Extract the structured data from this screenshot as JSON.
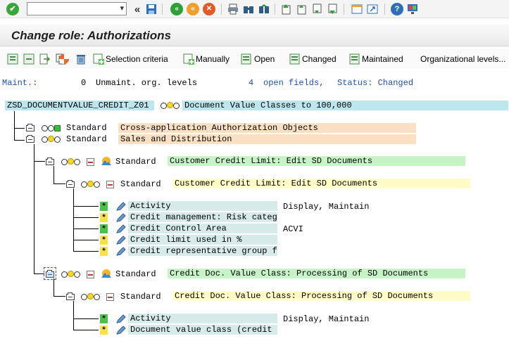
{
  "window": {
    "title": "Change role: Authorizations"
  },
  "colors": {
    "role_bg": "#bde6ee",
    "orange_bg": "#fbe0c4",
    "green_bg": "#c7f4c7",
    "yellow_bg": "#fffcc8",
    "field_bg": "#d6ebea",
    "star_green": "#4fc04f",
    "star_yellow": "#f7e04a"
  },
  "system_toolbar": {
    "command_field_value": "",
    "icons": [
      "enter-icon",
      "back-icon",
      "save-icon",
      "back-nav-icon",
      "exit-icon",
      "cancel-icon",
      "print-icon",
      "find-icon",
      "find-next-icon",
      "first-page-icon",
      "prev-page-icon",
      "next-page-icon",
      "last-page-icon",
      "new-session-icon",
      "shortcut-icon",
      "help-icon",
      "customize-layout-icon"
    ]
  },
  "app_toolbar": {
    "selection_criteria": "Selection criteria",
    "manually": "Manually",
    "open": "Open",
    "changed": "Changed",
    "maintained": "Maintained",
    "org_levels": "Organizational levels..."
  },
  "status_line": {
    "maint_label": "Maint.:",
    "maint_count": "0",
    "unmaint_text": "Unmaint. org. levels",
    "open_count": "4",
    "open_text": "open fields,",
    "status_text": "Status: Changed"
  },
  "tree": {
    "role": {
      "name": "ZSD_DOCUMENTVALUE_CREDIT_Z01",
      "desc": "Document Value Classes to 100,000"
    },
    "class1": {
      "label": "Standard",
      "desc": "Cross-application Authorization Objects"
    },
    "class2": {
      "label": "Standard",
      "desc": "Sales and Distribution"
    },
    "obj1": {
      "label": "Standard",
      "desc": "Customer Credit Limit: Edit SD Documents"
    },
    "auth1": {
      "label": "Standard",
      "desc": "Customer Credit Limit: Edit SD Documents"
    },
    "fields1": [
      {
        "name": "Activity",
        "value": "Display, Maintain",
        "star": "green"
      },
      {
        "name": "Credit management: Risk catego",
        "value": "",
        "star": "yellow"
      },
      {
        "name": "Credit Control Area",
        "value": "ACVI",
        "star": "green"
      },
      {
        "name": "Credit limit used in %",
        "value": "",
        "star": "yellow"
      },
      {
        "name": "Credit representative group fo",
        "value": "",
        "star": "yellow"
      }
    ],
    "obj2": {
      "label": "Standard",
      "desc": "Credit Doc. Value Class: Processing of SD Documents"
    },
    "auth2": {
      "label": "Standard",
      "desc": "Credit Doc. Value Class: Processing of SD Documents"
    },
    "fields2": [
      {
        "name": "Activity",
        "value": "Display, Maintain",
        "star": "green"
      },
      {
        "name": "Document value class (credit m",
        "value": "",
        "star": "yellow"
      }
    ]
  }
}
